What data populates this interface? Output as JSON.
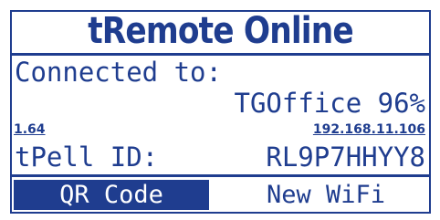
{
  "header": {
    "title": "tRemote Online"
  },
  "connection": {
    "label": "Connected to:",
    "ssid_signal": "TGOffice 96%"
  },
  "info": {
    "version": "1.64",
    "ip": "192.168.11.106"
  },
  "device": {
    "id_label": "tPell ID:",
    "id_value": "RL9P7HHYY8"
  },
  "buttons": {
    "qr_label": "QR Code",
    "wifi_label": "New WiFi"
  },
  "colors": {
    "accent": "#1f3d8f",
    "background": "#ffffff"
  }
}
